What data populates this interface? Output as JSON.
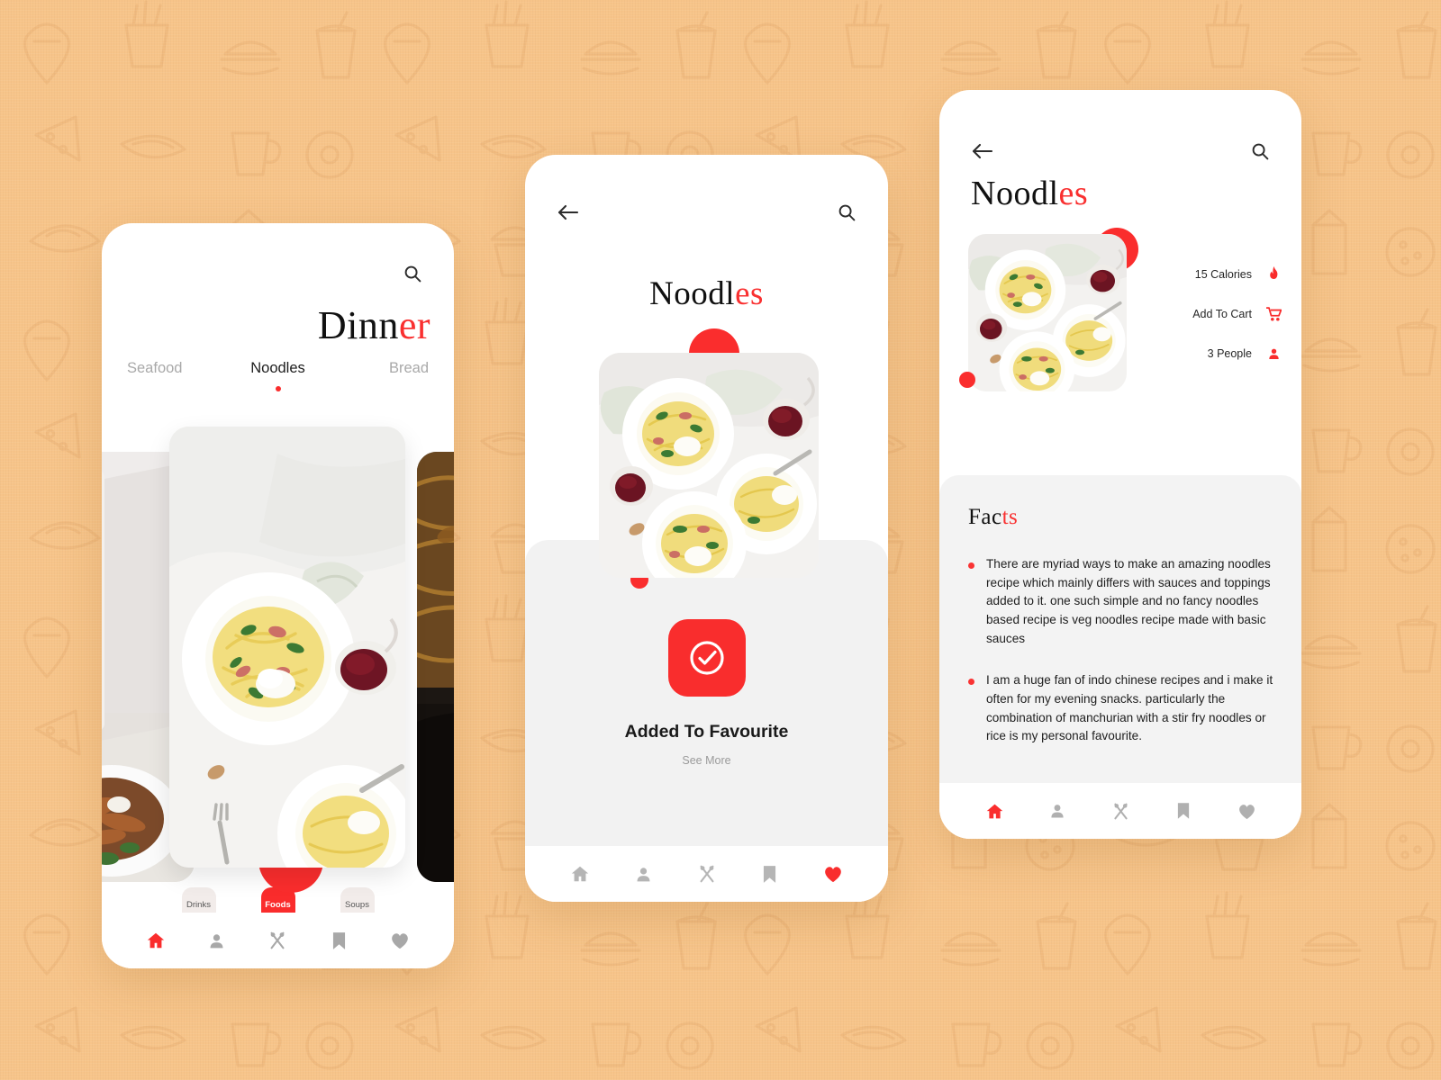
{
  "theme": {
    "background": "#f7c489",
    "accent": "#fa2d2d",
    "panel_gray": "#f2f2f2",
    "text_dark": "#111111",
    "text_muted": "#a9a9a9"
  },
  "phone_one": {
    "name": "dinner-listing-screen",
    "topbar": {
      "menu_icon": "hamburger-icon",
      "search_icon": "search-icon"
    },
    "title": {
      "plain": "Dinn",
      "accent": "er"
    },
    "tabs": [
      {
        "label": "Seafood",
        "active": false
      },
      {
        "label": "Noodles",
        "active": true
      },
      {
        "label": "Bread",
        "active": false
      }
    ],
    "cards": [
      {
        "name": "food-card-left",
        "alt": "marble table with noodle bowls"
      },
      {
        "name": "food-card-main",
        "alt": "white plate of spaghetti carbonara with wine"
      },
      {
        "name": "food-card-right",
        "alt": "stir fried noodles in pan"
      }
    ],
    "chips": [
      {
        "label": "Drinks",
        "active": false
      },
      {
        "label": "Foods",
        "active": true
      },
      {
        "label": "Soups",
        "active": false
      }
    ],
    "bottom_nav": [
      {
        "icon": "home-icon",
        "active": true
      },
      {
        "icon": "person-icon",
        "active": false
      },
      {
        "icon": "cutlery-icon",
        "active": false
      },
      {
        "icon": "bookmark-icon",
        "active": false
      },
      {
        "icon": "heart-icon",
        "active": false
      }
    ]
  },
  "phone_two": {
    "name": "added-to-favourite-screen",
    "topbar": {
      "back_icon": "back-arrow-icon",
      "menu_icon": "hamburger-icon",
      "search_icon": "search-icon"
    },
    "title": {
      "plain": "Noodl",
      "accent": "es"
    },
    "hero_alt": "overhead shot of three plates of spaghetti with red wine",
    "confirm_icon": "check-circle-icon",
    "status_label": "Added To Favourite",
    "see_more_label": "See More",
    "bottom_nav": [
      {
        "icon": "home-icon",
        "active": false
      },
      {
        "icon": "person-icon",
        "active": false
      },
      {
        "icon": "cutlery-icon",
        "active": false
      },
      {
        "icon": "bookmark-icon",
        "active": false
      },
      {
        "icon": "heart-icon",
        "active": true
      }
    ]
  },
  "phone_three": {
    "name": "noodles-detail-screen",
    "topbar": {
      "back_icon": "back-arrow-icon",
      "menu_icon": "hamburger-icon",
      "search_icon": "search-icon"
    },
    "title": {
      "plain": "Noodl",
      "accent": "es"
    },
    "hero_alt": "overhead shot of three plates of spaghetti with red wine",
    "info_rows": [
      {
        "label": "15 Calories",
        "icon": "flame-icon"
      },
      {
        "label": "Add To Cart",
        "icon": "cart-icon"
      },
      {
        "label": "3 People",
        "icon": "person-icon"
      }
    ],
    "facts": {
      "title": {
        "plain": "Fac",
        "accent": "ts"
      },
      "items": [
        "There are myriad ways to make an amazing noodles recipe which mainly differs with sauces and toppings added to it. one such simple and no fancy noodles based recipe is veg noodles recipe made with basic sauces",
        "I am a huge fan of indo chinese recipes and i make it often for my evening snacks. particularly the combination of manchurian with a stir fry noodles or rice is my personal favourite."
      ]
    },
    "bottom_nav": [
      {
        "icon": "home-icon",
        "active": true
      },
      {
        "icon": "person-icon",
        "active": false
      },
      {
        "icon": "cutlery-icon",
        "active": false
      },
      {
        "icon": "bookmark-icon",
        "active": false
      },
      {
        "icon": "heart-icon",
        "active": false
      }
    ]
  }
}
